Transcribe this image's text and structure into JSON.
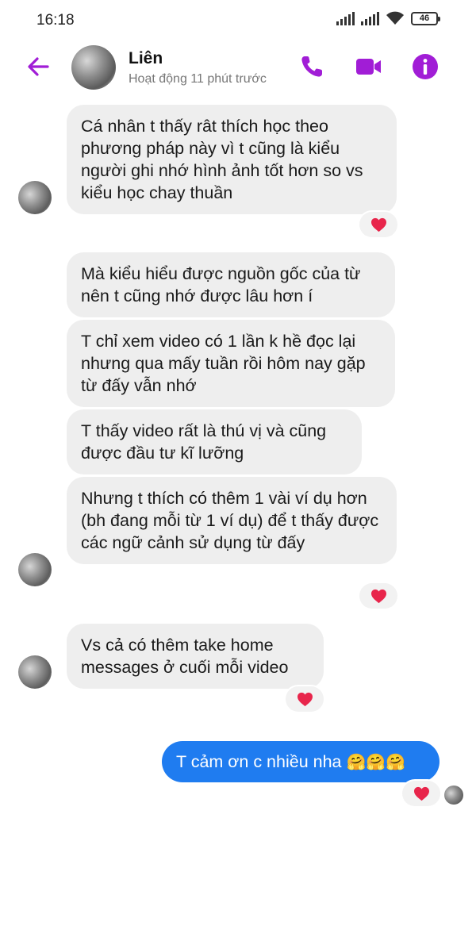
{
  "status_bar": {
    "time": "16:18",
    "battery": "46",
    "icons": [
      "signal-icon",
      "signal-icon",
      "wifi-icon",
      "battery-icon"
    ]
  },
  "header": {
    "contact_name": "Liên",
    "status": "Hoạt động 11 phút trước",
    "icons": [
      "back-arrow-icon",
      "phone-icon",
      "video-camera-icon",
      "info-icon"
    ]
  },
  "colors": {
    "accent": "#a11dd6",
    "outgoing_bubble": "#1f7cf0",
    "incoming_bubble": "#eeeeee",
    "reaction_heart": "#e8254b"
  },
  "messages": [
    {
      "direction": "incoming",
      "text": "Cá nhân t thấy rât thích học theo phương pháp này vì t cũng là kiểu người ghi nhớ hình ảnh tốt hơn so vs kiểu học chay thuần",
      "reaction": "heart"
    },
    {
      "direction": "incoming",
      "text": "Mà kiểu hiểu được nguồn gốc của từ nên t cũng nhớ được lâu hơn í"
    },
    {
      "direction": "incoming",
      "text": "T chỉ xem video có 1 lần k hề đọc lại nhưng qua mấy tuần rồi hôm nay gặp từ đấy vẫn nhớ"
    },
    {
      "direction": "incoming",
      "text": "T thấy video rất là thú vị và cũng được đầu tư kĩ lưỡng"
    },
    {
      "direction": "incoming",
      "text": "Nhưng t thích có thêm 1 vài ví dụ hơn (bh đang mỗi từ 1 ví dụ) để t thấy được các ngữ cảnh sử dụng từ đấy",
      "reaction": "heart"
    },
    {
      "direction": "incoming",
      "text": "Vs cả có thêm take home messages ở cuối mỗi video",
      "reaction": "heart"
    },
    {
      "direction": "outgoing",
      "text": "T cảm ơn c nhiều nha",
      "emoji": "🤗🤗🤗",
      "reaction": "heart"
    }
  ]
}
